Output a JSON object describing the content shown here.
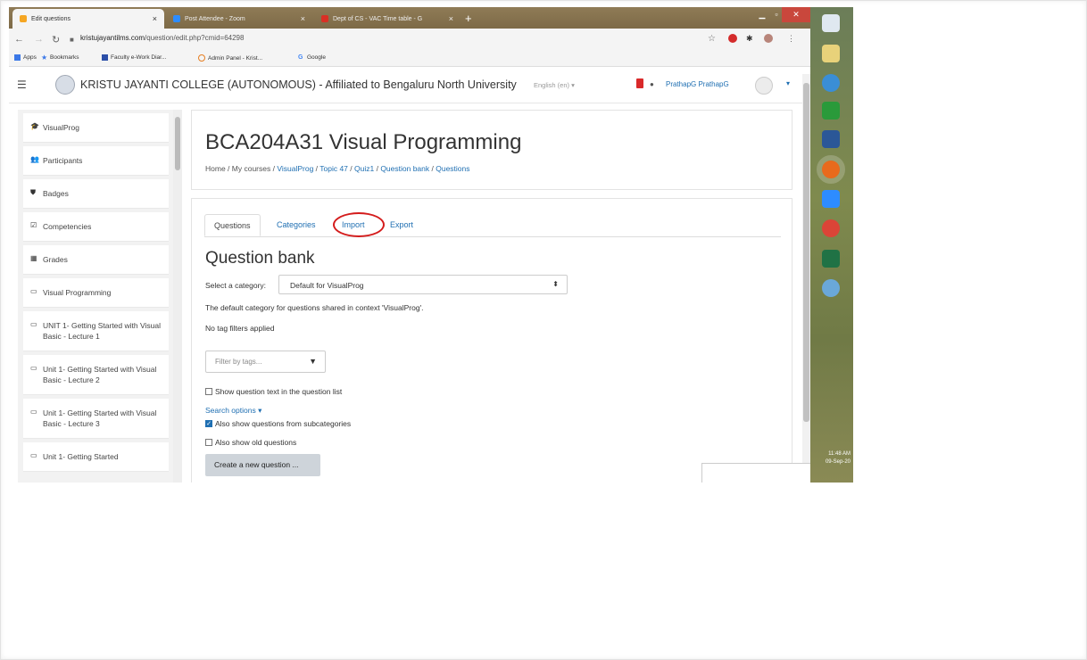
{
  "browser": {
    "tabs": [
      {
        "label": "Edit questions",
        "close": "×"
      },
      {
        "label": "Post Attendee - Zoom",
        "close": "×"
      },
      {
        "label": "Dept of CS - VAC Time table - G",
        "close": "×"
      }
    ],
    "new_tab": "+",
    "url_host": "kristujayantilms.com",
    "url_path": "/question/edit.php?cmid=64298",
    "bookmarks": [
      "Apps",
      "Bookmarks",
      "Faculty e-Work Diar...",
      "Admin Panel - Krist...",
      "Google"
    ]
  },
  "navbar": {
    "site_name": "KRISTU JAYANTI COLLEGE (AUTONOMOUS) - Affiliated to Bengaluru North University",
    "language": "English (en) ▾",
    "user_name": "PrathapG PrathapG"
  },
  "sidebar": {
    "items": [
      {
        "icon": "graduation-cap-icon",
        "glyph": "🎓",
        "label": "VisualProg"
      },
      {
        "icon": "users-icon",
        "glyph": "👥",
        "label": "Participants"
      },
      {
        "icon": "shield-icon",
        "glyph": "⛊",
        "label": "Badges"
      },
      {
        "icon": "check-square-icon",
        "glyph": "☑",
        "label": "Competencies"
      },
      {
        "icon": "table-icon",
        "glyph": "▦",
        "label": "Grades"
      },
      {
        "icon": "folder-icon",
        "glyph": "▭",
        "label": "Visual Programming"
      },
      {
        "icon": "folder-icon",
        "glyph": "▭",
        "label": "UNIT 1- Getting Started with Visual Basic - Lecture 1"
      },
      {
        "icon": "folder-icon",
        "glyph": "▭",
        "label": "Unit 1- Getting Started with Visual Basic - Lecture 2"
      },
      {
        "icon": "folder-icon",
        "glyph": "▭",
        "label": "Unit 1- Getting Started with Visual Basic - Lecture 3"
      },
      {
        "icon": "folder-icon",
        "glyph": "▭",
        "label": "Unit 1- Getting Started"
      }
    ]
  },
  "course": {
    "title": "BCA204A31 Visual Programming",
    "breadcrumb": [
      "Home",
      "My courses",
      "VisualProg",
      "Topic 47",
      "Quiz1",
      "Question bank",
      "Questions"
    ],
    "separator": " / "
  },
  "qbank": {
    "tabs": [
      "Questions",
      "Categories",
      "Import",
      "Export"
    ],
    "heading": "Question bank",
    "category_label": "Select a category:",
    "category_value": "Default for VisualProg",
    "category_desc": "The default category for questions shared in context 'VisualProg'.",
    "no_tags": "No tag filters applied",
    "filter_placeholder": "Filter by tags...",
    "show_text": "Show question text in the question list",
    "search_options": "Search options ▾",
    "subcats": "Also show questions from subcategories",
    "old_questions": "Also show old questions",
    "create_button": "Create a new question ..."
  },
  "taskbar": {
    "clock_time": "11:48 AM",
    "clock_date": "09-Sep-20"
  }
}
